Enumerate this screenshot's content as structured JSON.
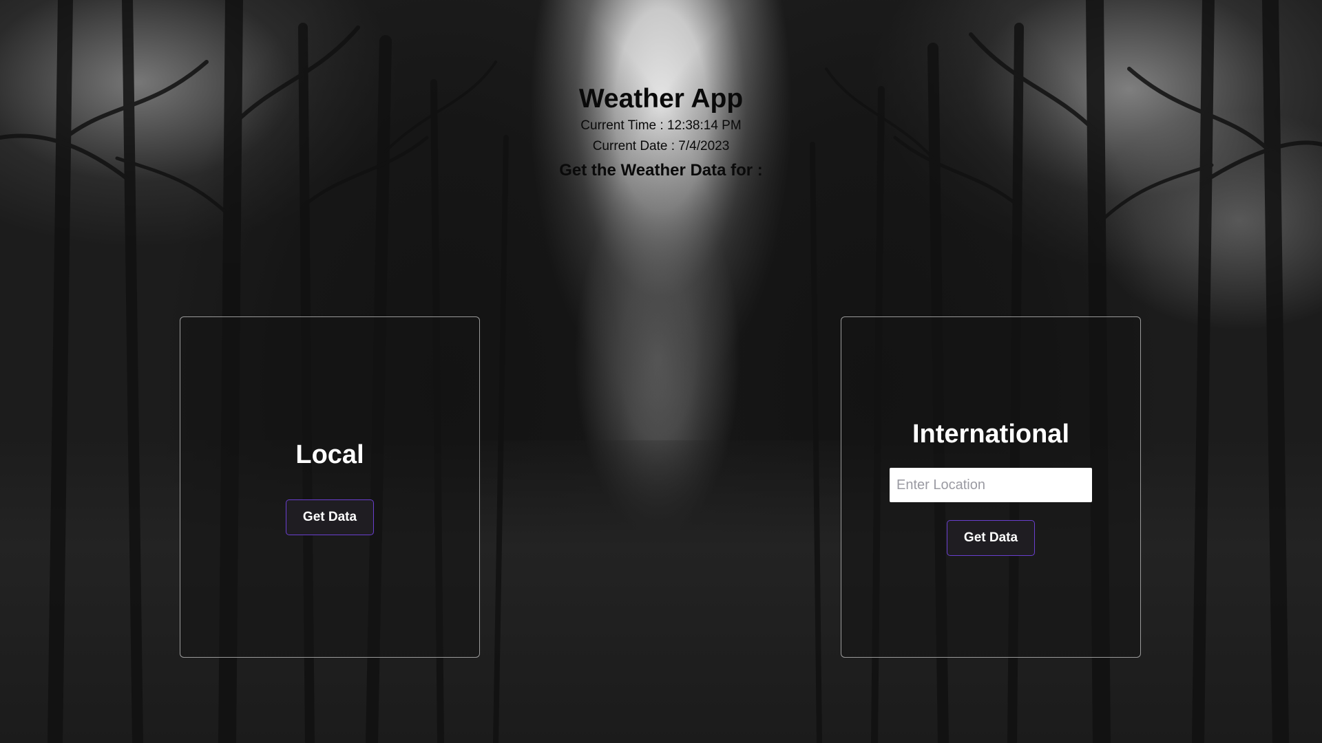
{
  "header": {
    "title": "Weather App",
    "time_line": "Current Time : 12:38:14 PM",
    "date_line": "Current Date : 7/4/2023",
    "subtitle": "Get the Weather Data for :"
  },
  "local_card": {
    "title": "Local",
    "button_label": "Get Data"
  },
  "international_card": {
    "title": "International",
    "input_value": "",
    "input_placeholder": "Enter Location",
    "button_label": "Get Data"
  },
  "colors": {
    "button_border": "#6a3fd0",
    "button_bg": "#1f1d22",
    "card_border": "#c8c8c8"
  }
}
